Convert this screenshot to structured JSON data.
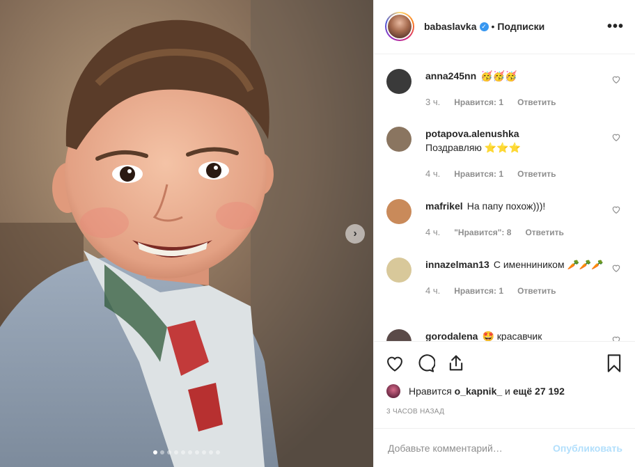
{
  "post": {
    "slide_count": 10,
    "active_slide": 1,
    "next_glyph": "›"
  },
  "header": {
    "username": "babaslavka",
    "verified_glyph": "✓",
    "bullet": "•",
    "follow_label": "Подписки",
    "more_glyph": "•••"
  },
  "comments": [
    {
      "username": "anna245nn",
      "text": "🥳🥳🥳",
      "time": "3 ч.",
      "likes": "Нравится: 1",
      "reply": "Ответить",
      "avatar_color": "#3a3a3a"
    },
    {
      "username": "potapova.alenushka",
      "text": "Поздравляю ⭐⭐⭐",
      "time": "4 ч.",
      "likes": "Нравится: 1",
      "reply": "Ответить",
      "avatar_color": "#8a7560"
    },
    {
      "username": "mafrikel",
      "text": "На папу похож)))!",
      "time": "4 ч.",
      "likes": "\"Нравится\": 8",
      "reply": "Ответить",
      "avatar_color": "#c98a5a"
    },
    {
      "username": "innazelman13",
      "text": "С именниником 🥕🥕🥕",
      "time": "4 ч.",
      "likes": "Нравится: 1",
      "reply": "Ответить",
      "avatar_color": "#d8c89a"
    },
    {
      "username": "gorodalena",
      "text": "🤩 красавчик",
      "time": "",
      "likes": "",
      "reply": "",
      "avatar_color": "#5a4a48"
    }
  ],
  "likes": {
    "prefix": "Нравится",
    "user": "o_kapnik_",
    "middle": "и",
    "rest": "ещё 27 192"
  },
  "posted": "3 ЧАСОВ НАЗАД",
  "add_comment": {
    "placeholder": "Добавьте комментарий…",
    "publish_label": "Опубликовать"
  },
  "colors": {
    "accent": "#3897f0",
    "publish_disabled": "#b2dffc",
    "muted": "#8e8e8e"
  }
}
